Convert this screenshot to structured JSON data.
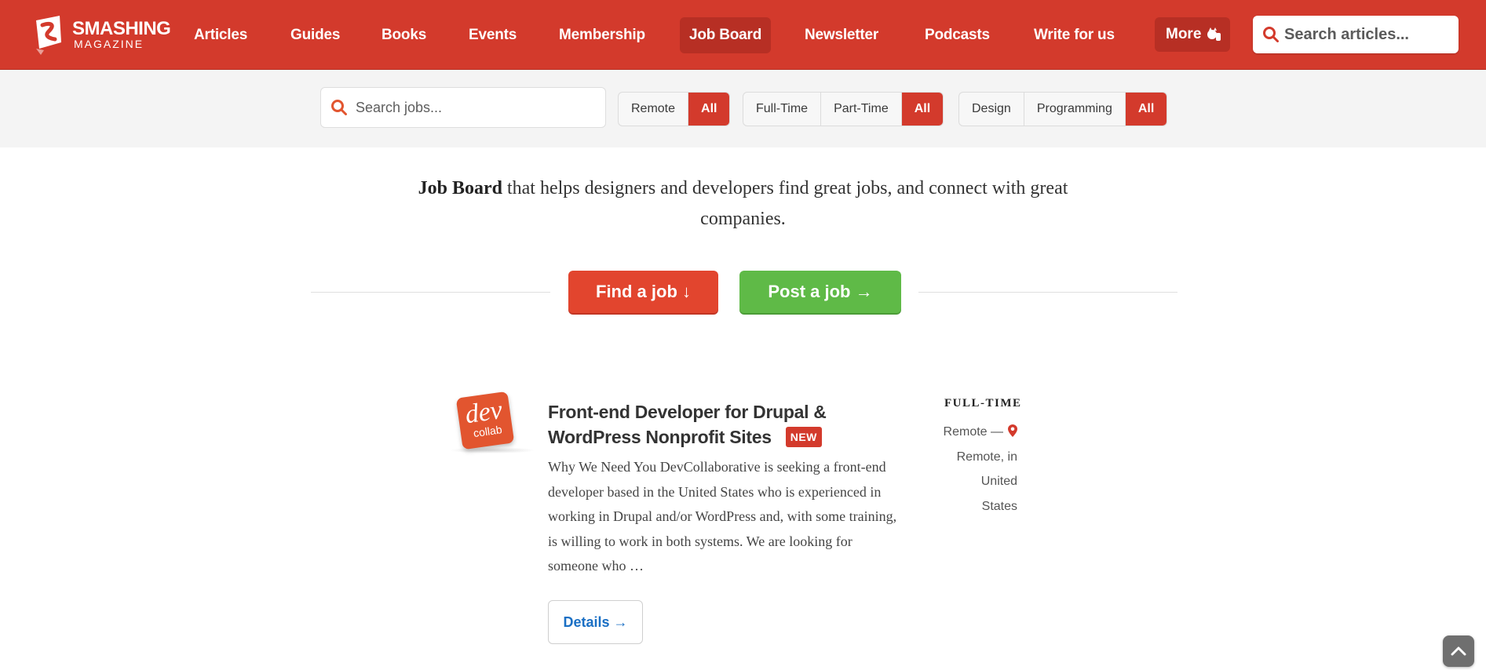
{
  "brand": {
    "line1": "SMASHING",
    "line2": "MAGAZINE"
  },
  "nav": {
    "items": [
      {
        "label": "Articles"
      },
      {
        "label": "Guides"
      },
      {
        "label": "Books"
      },
      {
        "label": "Events"
      },
      {
        "label": "Membership"
      },
      {
        "label": "Job Board",
        "active": true
      },
      {
        "label": "Newsletter"
      },
      {
        "label": "Podcasts"
      },
      {
        "label": "Write for us"
      }
    ],
    "more_label": "More",
    "search_placeholder": "Search articles..."
  },
  "filters": {
    "search_placeholder": "Search jobs...",
    "location": [
      "Remote",
      "All"
    ],
    "employment": [
      "Full-Time",
      "Part-Time",
      "All"
    ],
    "category": [
      "Design",
      "Programming",
      "All"
    ],
    "selected": {
      "location": "All",
      "employment": "All",
      "category": "All"
    }
  },
  "intro": {
    "bold": "Job Board",
    "text": " that helps designers and developers find great jobs, and connect with great companies."
  },
  "cta": {
    "find": "Find a job ↓",
    "post": "Post a job →"
  },
  "job": {
    "logo_text": "dev",
    "logo_subtext": "collab",
    "title": "Front-end Developer for Drupal & WordPress Nonprofit Sites",
    "badge": "NEW",
    "description": "Why We Need You DevCollaborative is seeking a front-end developer based in the United States who is experienced in working in Drupal and/or WordPress and, with some training, is willing to work in both systems. We are looking for someone who …",
    "details_label": "Details →",
    "type": "FULL-TIME",
    "location_line1": "Remote —",
    "location_line2": "Remote, in",
    "location_line3": "United",
    "location_line4": "States"
  },
  "colors": {
    "brand_red": "#d33a2c",
    "find_orange": "#e2452e",
    "post_green": "#5fba47",
    "link_blue": "#1a6fc4"
  }
}
